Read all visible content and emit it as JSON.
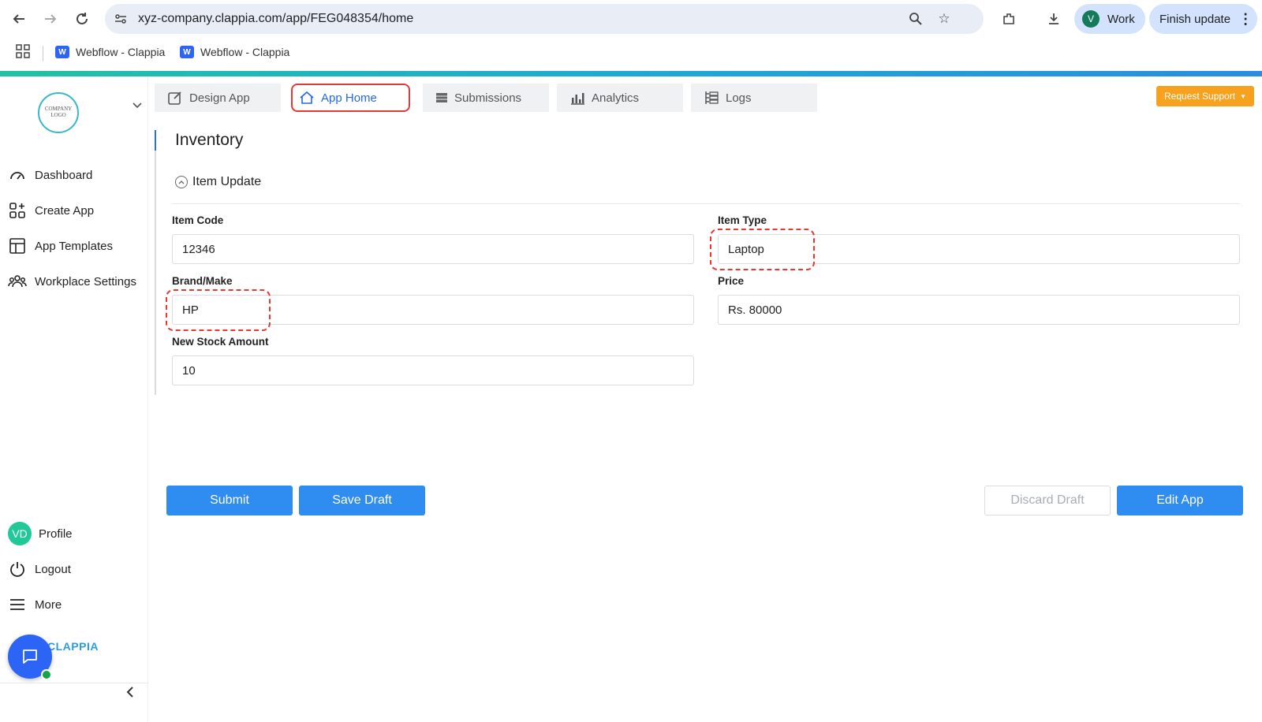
{
  "browser": {
    "url": "xyz-company.clappia.com/app/FEG048354/home",
    "profile_initial": "V",
    "profile_label": "Work",
    "finish_update_label": "Finish update",
    "bookmarks": [
      {
        "label": "Webflow - Clappia"
      },
      {
        "label": "Webflow - Clappia"
      }
    ]
  },
  "sidebar": {
    "logo_text": "COMPANY LOGO",
    "items": [
      {
        "label": "Dashboard",
        "icon": "gauge-icon"
      },
      {
        "label": "Create App",
        "icon": "grid-plus-icon"
      },
      {
        "label": "App Templates",
        "icon": "template-icon"
      },
      {
        "label": "Workplace Settings",
        "icon": "people-icon"
      }
    ],
    "profile": {
      "initials": "VD",
      "label": "Profile"
    },
    "logout_label": "Logout",
    "more_label": "More",
    "brand": "CLAPPIA"
  },
  "tabs": [
    {
      "label": "Design App",
      "icon": "edit-icon",
      "active": false
    },
    {
      "label": "App Home",
      "icon": "home-icon",
      "active": true
    },
    {
      "label": "Submissions",
      "icon": "table-icon",
      "active": false
    },
    {
      "label": "Analytics",
      "icon": "bar-chart-icon",
      "active": false
    },
    {
      "label": "Logs",
      "icon": "logs-icon",
      "active": false
    }
  ],
  "request_support_label": "Request Support",
  "form": {
    "title": "Inventory",
    "section": "Item Update",
    "fields": {
      "item_code": {
        "label": "Item Code",
        "value": "12346"
      },
      "item_type": {
        "label": "Item Type",
        "value": "Laptop"
      },
      "brand": {
        "label": "Brand/Make",
        "value": "HP"
      },
      "price": {
        "label": "Price",
        "value": "Rs. 80000"
      },
      "stock": {
        "label": "New Stock Amount",
        "value": "10"
      }
    },
    "buttons": {
      "submit": "Submit",
      "save_draft": "Save Draft",
      "discard_draft": "Discard Draft",
      "edit_app": "Edit App"
    }
  },
  "colors": {
    "accent": "#2f8cf0",
    "highlight": "#e53935",
    "support": "#f6a21e"
  }
}
